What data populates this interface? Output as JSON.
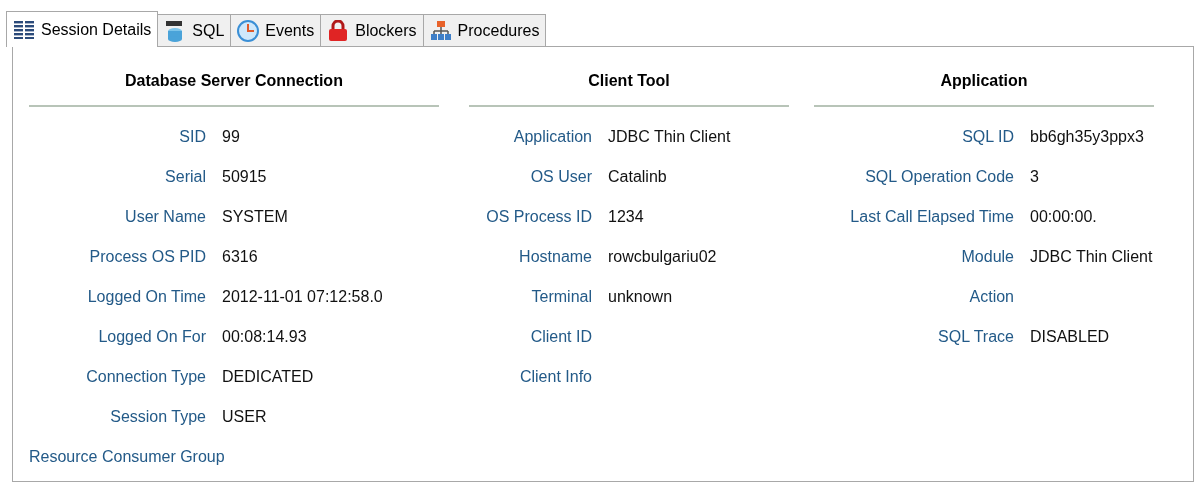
{
  "tabs": [
    {
      "label": "Session Details",
      "kind": "list",
      "selected": true
    },
    {
      "label": "SQL",
      "kind": "sql",
      "selected": false
    },
    {
      "label": "Events",
      "kind": "clock",
      "selected": false
    },
    {
      "label": "Blockers",
      "kind": "lock",
      "selected": false
    },
    {
      "label": "Procedures",
      "kind": "tree",
      "selected": false
    }
  ],
  "sections": [
    {
      "title": "Database Server Connection",
      "fields": [
        {
          "label": "SID",
          "value": "99"
        },
        {
          "label": "Serial",
          "value": "50915"
        },
        {
          "label": "User Name",
          "value": "SYSTEM"
        },
        {
          "label": "Process OS PID",
          "value": "6316"
        },
        {
          "label": "Logged On Time",
          "value": "2012-11-01 07:12:58.0"
        },
        {
          "label": "Logged On For",
          "value": "00:08:14.93"
        },
        {
          "label": "Connection Type",
          "value": "DEDICATED"
        },
        {
          "label": "Session Type",
          "value": "USER"
        },
        {
          "label": "Resource Consumer Group"
        }
      ]
    },
    {
      "title": "Client Tool",
      "fields": [
        {
          "label": "Application",
          "value": "JDBC Thin Client"
        },
        {
          "label": "OS User",
          "value": "Catalinb"
        },
        {
          "label": "OS Process ID",
          "value": "1234"
        },
        {
          "label": "Hostname",
          "value": "rowcbulgariu02"
        },
        {
          "label": "Terminal",
          "value": "unknown"
        },
        {
          "label": "Client ID"
        },
        {
          "label": "Client Info"
        }
      ]
    },
    {
      "title": "Application",
      "fields": [
        {
          "label": "SQL ID",
          "value": "bb6gh35y3ppx3"
        },
        {
          "label": "SQL Operation Code",
          "value": "3"
        },
        {
          "label": "Last Call Elapsed Time",
          "value": "00:00:00."
        },
        {
          "label": "Module",
          "value": "JDBC Thin Client"
        },
        {
          "label": "Action"
        },
        {
          "label": "SQL Trace",
          "value": "DISABLED"
        }
      ]
    }
  ]
}
